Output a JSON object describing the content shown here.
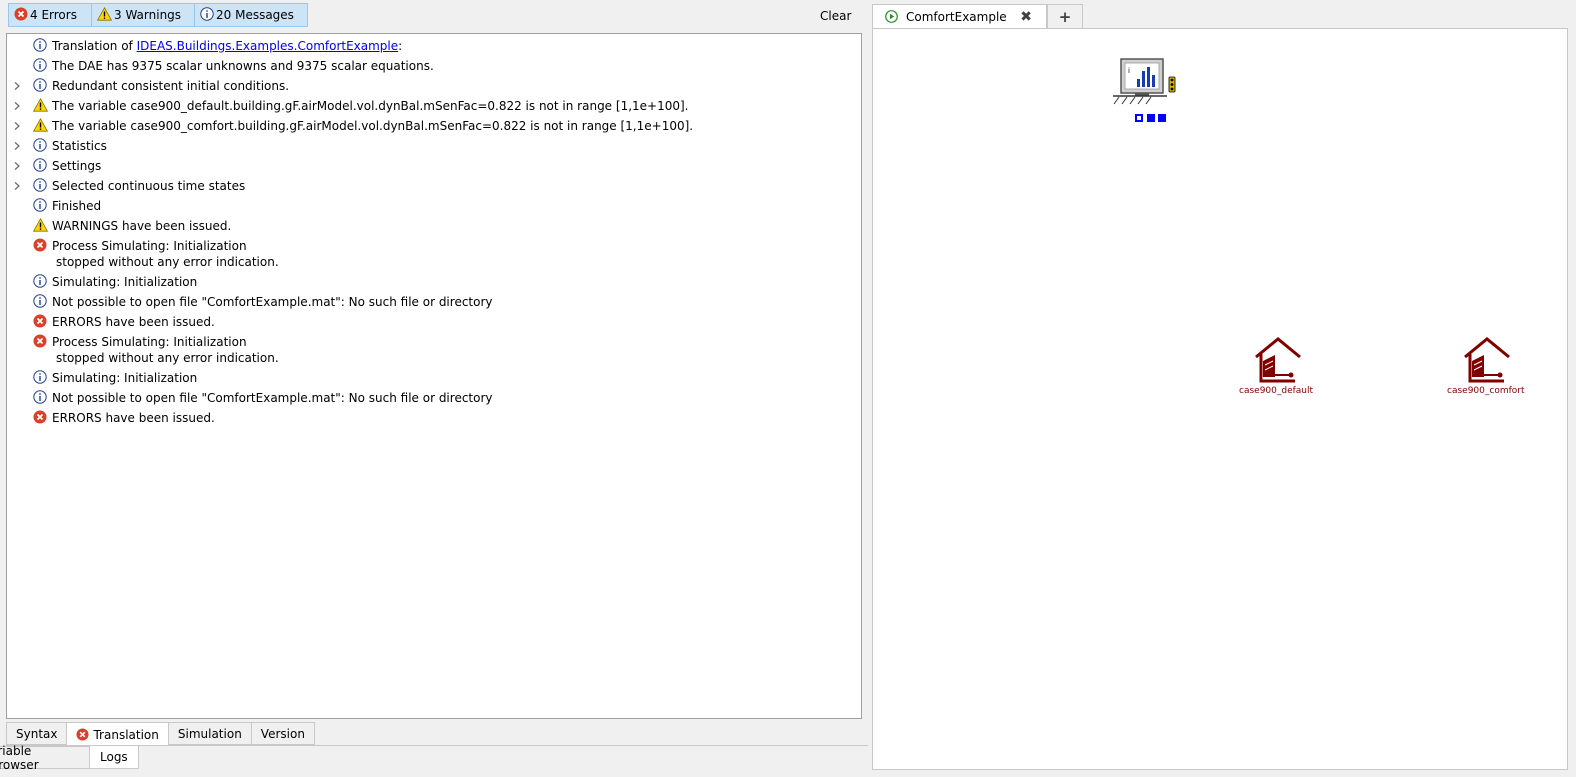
{
  "filters": {
    "errors": "4 Errors",
    "warnings": "3 Warnings",
    "messages": "20 Messages"
  },
  "clear_label": "Clear",
  "messages": [
    {
      "type": "info",
      "expandable": false,
      "text": "Translation of ",
      "link": "IDEAS.Buildings.Examples.ComfortExample",
      "suffix": ":"
    },
    {
      "type": "info",
      "expandable": false,
      "text": "The DAE has 9375 scalar unknowns and 9375 scalar equations."
    },
    {
      "type": "info",
      "expandable": true,
      "text": "Redundant consistent initial conditions."
    },
    {
      "type": "warning",
      "expandable": true,
      "text": "The variable case900_default.building.gF.airModel.vol.dynBal.mSenFac=0.822 is not in range [1,1e+100]."
    },
    {
      "type": "warning",
      "expandable": true,
      "text": "The variable case900_comfort.building.gF.airModel.vol.dynBal.mSenFac=0.822 is not in range [1,1e+100]."
    },
    {
      "type": "info",
      "expandable": true,
      "text": "Statistics"
    },
    {
      "type": "info",
      "expandable": true,
      "text": "Settings"
    },
    {
      "type": "info",
      "expandable": true,
      "text": "Selected continuous time states"
    },
    {
      "type": "info",
      "expandable": false,
      "text": "Finished"
    },
    {
      "type": "warning",
      "expandable": false,
      "text": "WARNINGS have been issued."
    },
    {
      "type": "error",
      "expandable": false,
      "text": "Process Simulating: Initialization",
      "line2": "stopped without any error indication."
    },
    {
      "type": "info",
      "expandable": false,
      "text": "Simulating: Initialization"
    },
    {
      "type": "info",
      "expandable": false,
      "text": "Not possible to open file \"ComfortExample.mat\": No such file or directory"
    },
    {
      "type": "error",
      "expandable": false,
      "text": "ERRORS have been issued."
    },
    {
      "type": "error",
      "expandable": false,
      "text": "Process Simulating: Initialization",
      "line2": "stopped without any error indication."
    },
    {
      "type": "info",
      "expandable": false,
      "text": "Simulating: Initialization"
    },
    {
      "type": "info",
      "expandable": false,
      "text": "Not possible to open file \"ComfortExample.mat\": No such file or directory"
    },
    {
      "type": "error",
      "expandable": false,
      "text": "ERRORS have been issued."
    }
  ],
  "bottom_tabs": {
    "syntax": "Syntax",
    "translation": "Translation",
    "simulation": "Simulation",
    "version": "Version",
    "variable_browser": "ariable Browser",
    "logs": "Logs"
  },
  "document_tab": {
    "title": "ComfortExample",
    "close": "✖",
    "add": "+"
  },
  "components": {
    "default_label": "case900_default",
    "comfort_label": "case900_comfort"
  },
  "colors": {
    "error": "#d9412a",
    "warning": "#ffd700",
    "info": "#1f3f8f",
    "component": "#800000",
    "filter_bg": "#cde4f7"
  }
}
